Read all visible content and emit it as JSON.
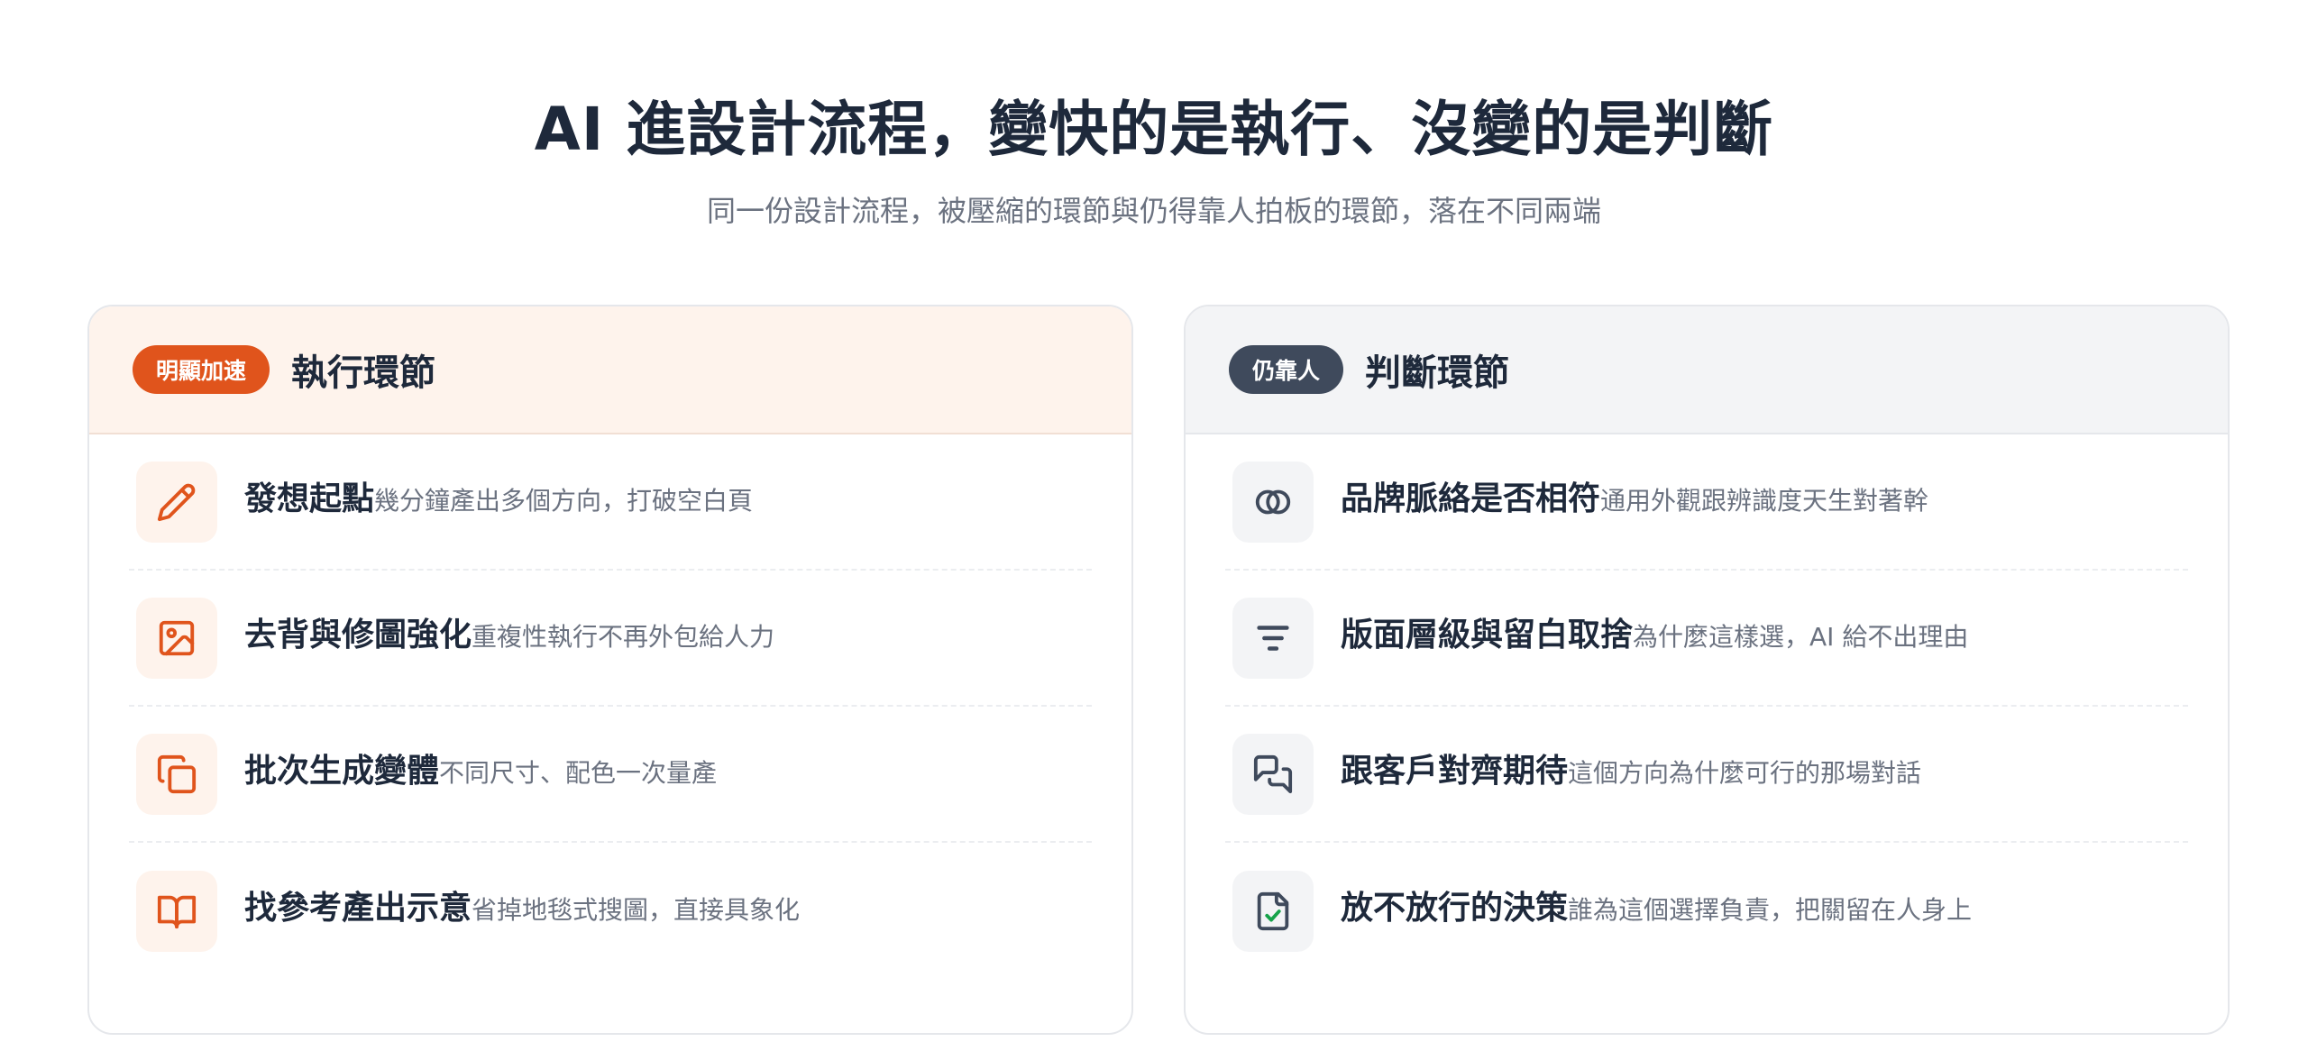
{
  "header": {
    "title": "AI 進設計流程，變快的是執行、沒變的是判斷",
    "subtitle": "同一份設計流程，被壓縮的環節與仍得靠人拍板的環節，落在不同兩端"
  },
  "left": {
    "badge": "明顯加速",
    "title": "執行環節",
    "accent": "#e0541c",
    "items": [
      {
        "icon": "pencil-icon",
        "title": "發想起點",
        "desc": "幾分鐘產出多個方向，打破空白頁"
      },
      {
        "icon": "image-icon",
        "title": "去背與修圖強化",
        "desc": "重複性執行不再外包給人力"
      },
      {
        "icon": "copy-icon",
        "title": "批次生成變體",
        "desc": "不同尺寸、配色一次量產"
      },
      {
        "icon": "book-open-icon",
        "title": "找參考產出示意",
        "desc": "省掉地毯式搜圖，直接具象化"
      }
    ]
  },
  "right": {
    "badge": "仍靠人",
    "title": "判斷環節",
    "accent": "#3f4a5c",
    "items": [
      {
        "icon": "linked-circles-icon",
        "title": "品牌脈絡是否相符",
        "desc": "通用外觀跟辨識度天生對著幹"
      },
      {
        "icon": "hierarchy-lines-icon",
        "title": "版面層級與留白取捨",
        "desc": "為什麼這樣選，AI 給不出理由"
      },
      {
        "icon": "chat-bubbles-icon",
        "title": "跟客戶對齊期待",
        "desc": "這個方向為什麼可行的那場對話"
      },
      {
        "icon": "file-check-icon",
        "title": "放不放行的決策",
        "desc": "誰為這個選擇負責，把關留在人身上"
      }
    ]
  }
}
